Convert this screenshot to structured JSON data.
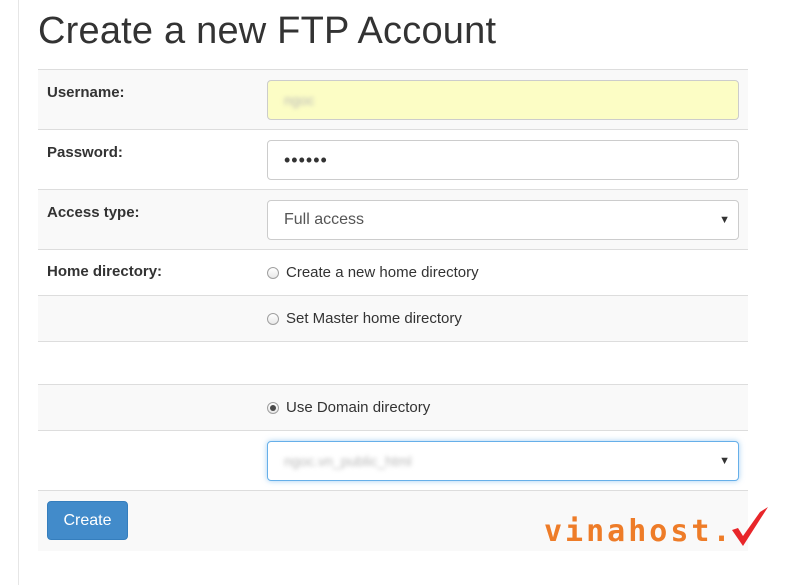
{
  "page": {
    "title": "Create a new FTP Account"
  },
  "form": {
    "username": {
      "label": "Username:",
      "value": "ngoc"
    },
    "password": {
      "label": "Password:",
      "value": "••••••"
    },
    "access_type": {
      "label": "Access type:",
      "selected": "Full access"
    },
    "home_directory": {
      "label": "Home directory:",
      "options": [
        {
          "label": "Create a new home directory",
          "checked": false
        },
        {
          "label": "Set Master home directory",
          "checked": false
        },
        {
          "label": "Use Domain directory",
          "checked": true
        }
      ],
      "domain_select_value": "ngoc.vn_public_html"
    },
    "create_button": "Create"
  },
  "watermark": {
    "text": "vinahost.",
    "color": "#ee7c28",
    "check_color": "#e8262a"
  }
}
